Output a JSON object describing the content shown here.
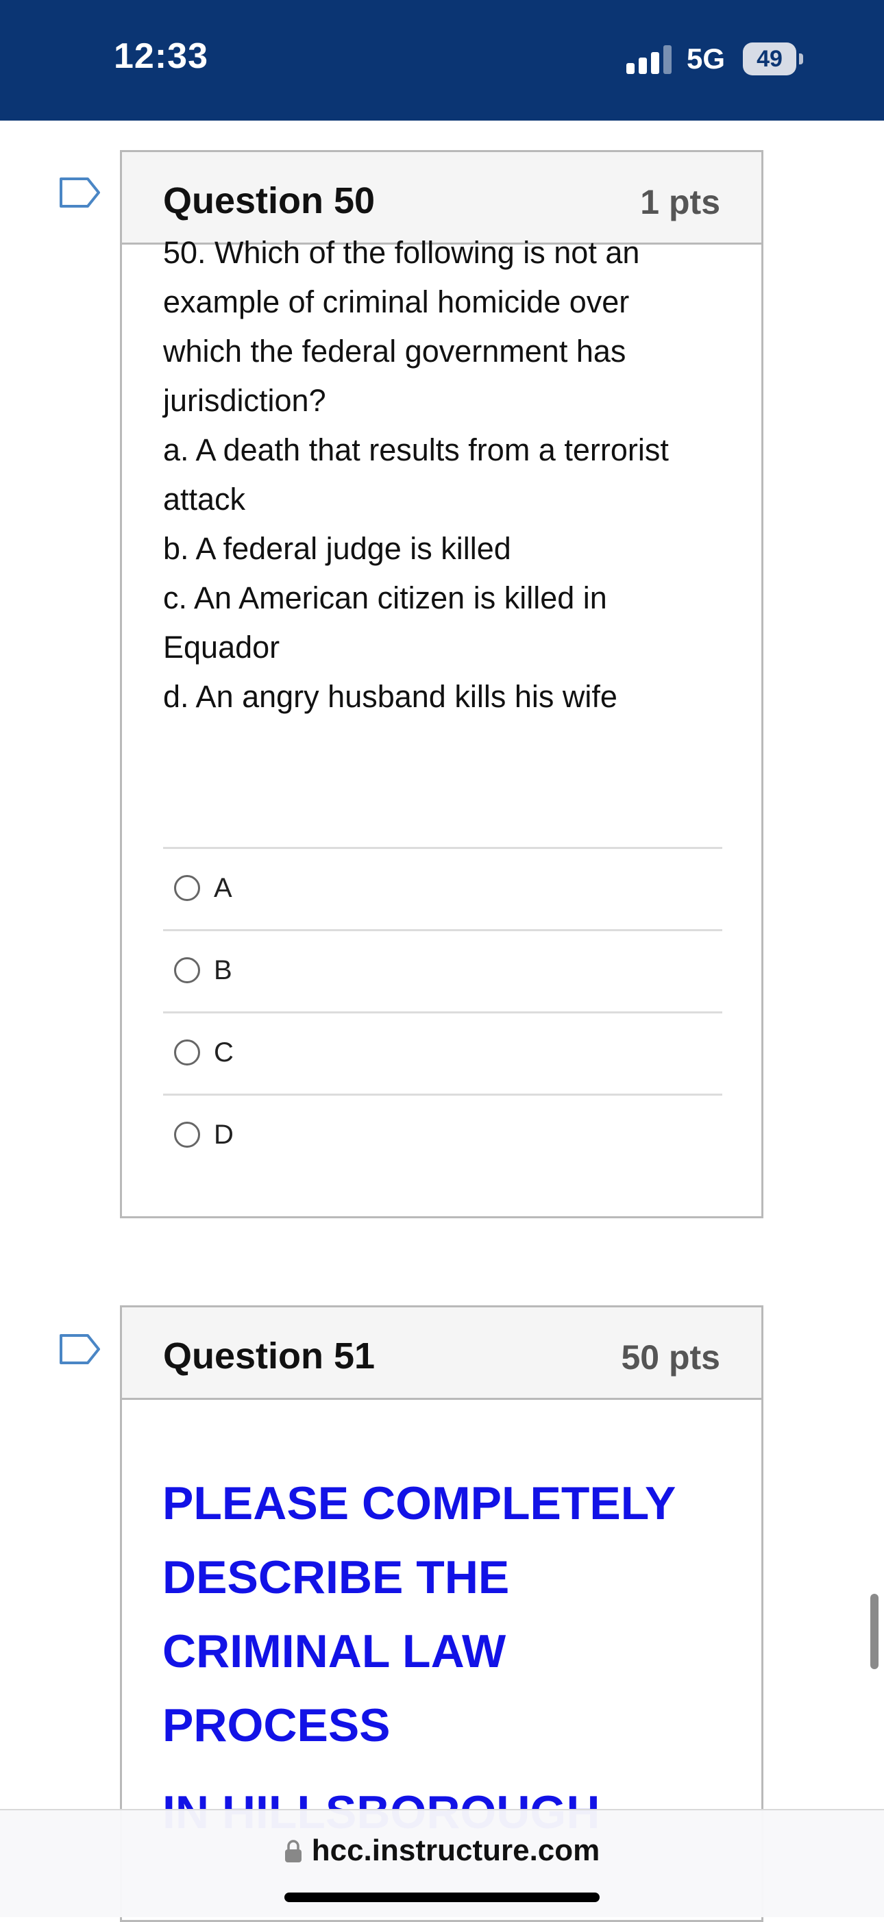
{
  "status_bar": {
    "time": "12:33",
    "network": "5G",
    "battery": "49"
  },
  "question_50": {
    "title": "Question 50",
    "points": "1 pts",
    "text_lines": [
      "50. Which of the following is not an",
      "example of criminal homicide over",
      "which the federal government has",
      "jurisdiction?",
      "a. A death that results from a terrorist",
      "attack",
      "b. A federal judge is killed",
      "c. An American citizen is killed in",
      "Equador",
      "d. An angry husband kills his wife"
    ],
    "options": [
      "A",
      "B",
      "C",
      "D"
    ]
  },
  "question_51": {
    "title": "Question 51",
    "points": "50 pts",
    "text_lines": [
      "PLEASE COMPLETELY",
      "DESCRIBE THE",
      "CRIMINAL LAW",
      "PROCESS"
    ],
    "cut_off_line": "IN HILLSBOROUGH"
  },
  "browser": {
    "url": "hcc.instructure.com"
  },
  "colors": {
    "status_bar_bg": "#0b3573",
    "flag_outline": "#4a86c5",
    "prompt_text": "#1212e6"
  },
  "icons": [
    "signal-icon",
    "battery-icon",
    "flag-icon",
    "lock-icon"
  ]
}
